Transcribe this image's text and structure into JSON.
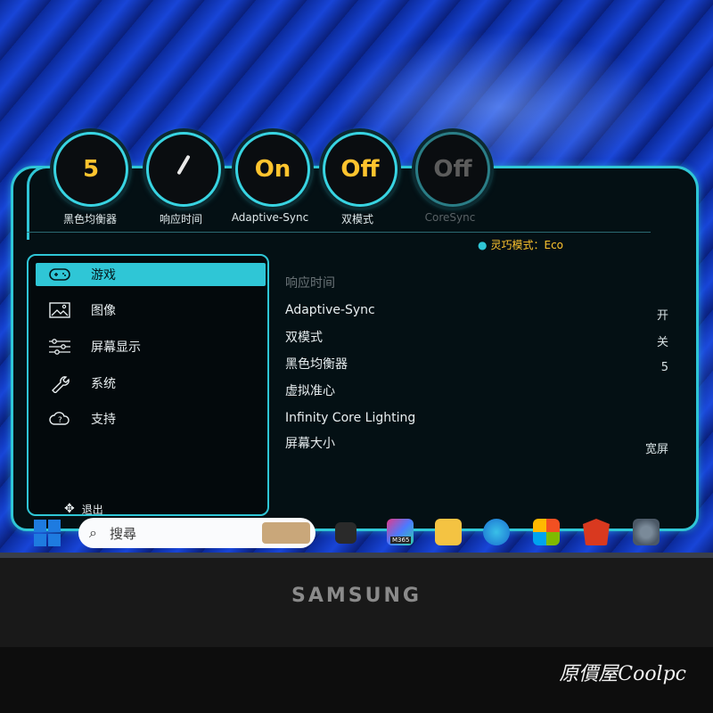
{
  "osd": {
    "dials": [
      {
        "value": "5",
        "label": "黑色均衡器"
      },
      {
        "value": "",
        "label": "响应时间"
      },
      {
        "value": "On",
        "label": "Adaptive-Sync"
      },
      {
        "value": "Off",
        "label": "双模式"
      },
      {
        "value": "Off",
        "label": "CoreSync"
      }
    ],
    "mode_label": "灵巧模式：Eco",
    "menu": [
      {
        "label": "游戏",
        "icon": "gamepad-icon",
        "selected": true
      },
      {
        "label": "图像",
        "icon": "picture-icon"
      },
      {
        "label": "屏幕显示",
        "icon": "sliders-icon"
      },
      {
        "label": "系统",
        "icon": "wrench-icon"
      },
      {
        "label": "支持",
        "icon": "help-cloud-icon"
      }
    ],
    "exit_label": "退出",
    "settings": [
      {
        "label": "响应时间",
        "value": "",
        "dim": true
      },
      {
        "label": "Adaptive-Sync",
        "value": "开"
      },
      {
        "label": "双模式",
        "value": "关"
      },
      {
        "label": "黑色均衡器",
        "value": "5"
      },
      {
        "label": "虚拟准心",
        "value": ""
      },
      {
        "label": "Infinity Core Lighting",
        "value": ""
      },
      {
        "label": "屏幕大小",
        "value": "宽屏"
      }
    ],
    "accent_color": "#2fc6d6",
    "value_color": "#ffc42e"
  },
  "taskbar": {
    "search_placeholder": "搜尋",
    "m365_badge": "M365"
  },
  "monitor": {
    "brand": "SAMSUNG"
  },
  "watermark": "原價屋Coolpc"
}
